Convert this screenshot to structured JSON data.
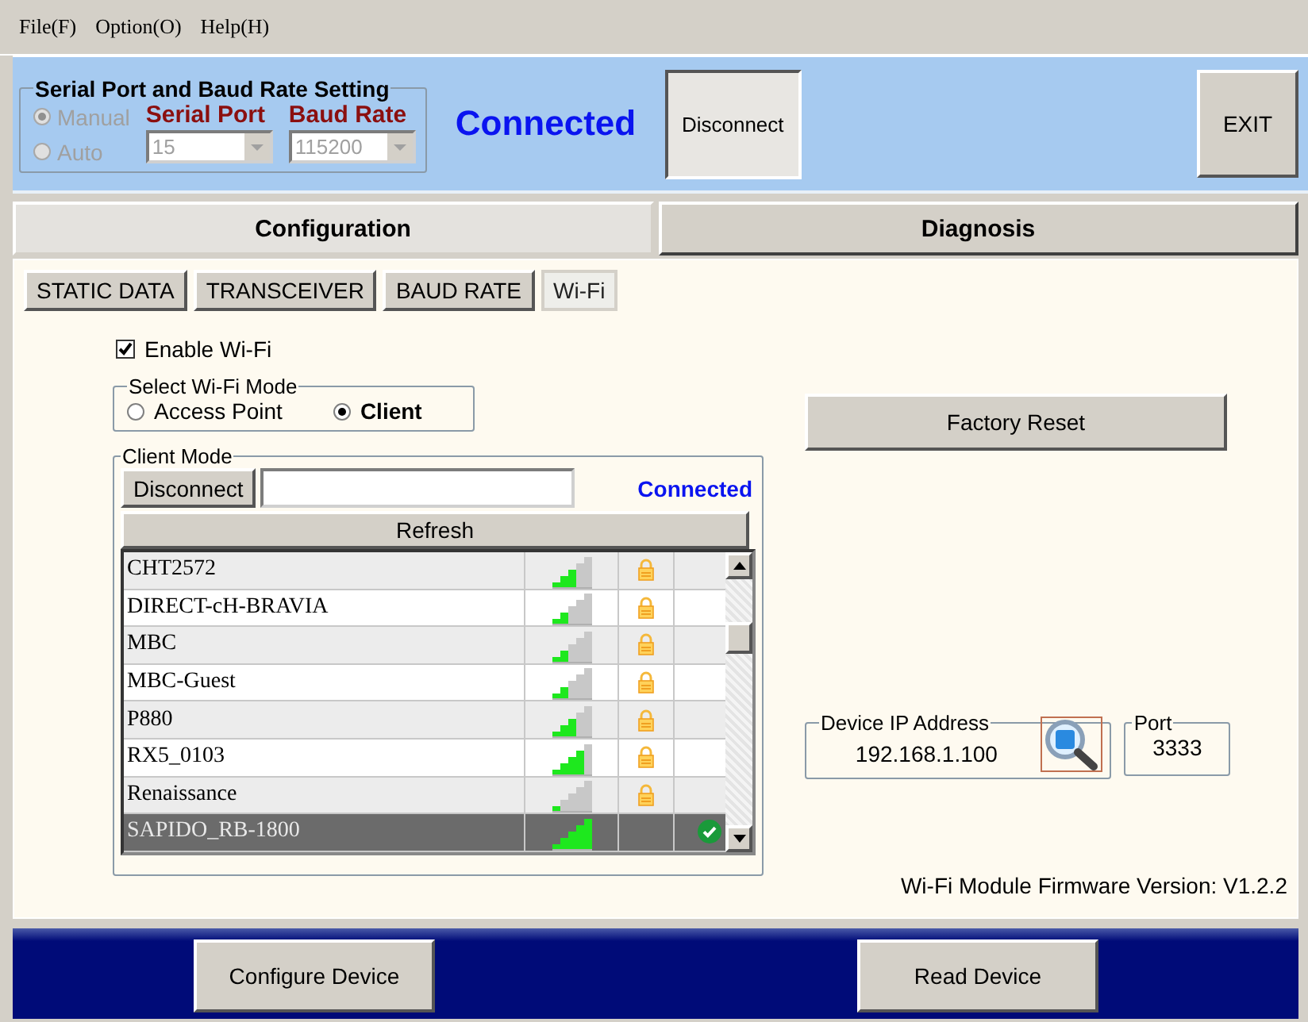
{
  "menu": [
    {
      "label": "File(F)"
    },
    {
      "label": "Option(O)"
    },
    {
      "label": "Help(H)"
    }
  ],
  "serial": {
    "title": "Serial Port and Baud Rate Setting",
    "modes": [
      {
        "label": "Manual",
        "selected": true
      },
      {
        "label": "Auto",
        "selected": false
      }
    ],
    "port_label": "Serial Port",
    "port_value": "15",
    "baud_label": "Baud Rate",
    "baud_value": "115200",
    "status": "Connected",
    "disconnect": "Disconnect",
    "exit": "EXIT"
  },
  "main_tabs": [
    {
      "label": "Configuration",
      "selected": true
    },
    {
      "label": "Diagnosis",
      "selected": false
    }
  ],
  "sub_tabs": [
    {
      "label": "STATIC DATA",
      "selected": false
    },
    {
      "label": "TRANSCEIVER",
      "selected": false
    },
    {
      "label": "BAUD RATE",
      "selected": false
    },
    {
      "label": "Wi-Fi",
      "selected": true
    }
  ],
  "enable_wifi": {
    "label": "Enable Wi-Fi",
    "checked": true
  },
  "wifi_mode": {
    "title": "Select Wi-Fi Mode",
    "options": [
      {
        "label": "Access Point",
        "selected": false
      },
      {
        "label": "Client",
        "selected": true
      }
    ]
  },
  "client_mode": {
    "title": "Client Mode",
    "disconnect": "Disconnect",
    "status": "Connected",
    "refresh": "Refresh",
    "networks": [
      {
        "name": "CHT2572",
        "level": 0.6,
        "locked": true,
        "connected": false,
        "selected": false
      },
      {
        "name": "DIRECT-cH-BRAVIA",
        "level": 0.4,
        "locked": true,
        "connected": false,
        "selected": false
      },
      {
        "name": "MBC",
        "level": 0.4,
        "locked": true,
        "connected": false,
        "selected": false
      },
      {
        "name": "MBC-Guest",
        "level": 0.4,
        "locked": true,
        "connected": false,
        "selected": false
      },
      {
        "name": "P880",
        "level": 0.6,
        "locked": true,
        "connected": false,
        "selected": false
      },
      {
        "name": "RX5_0103",
        "level": 0.8,
        "locked": true,
        "connected": false,
        "selected": false
      },
      {
        "name": "Renaissance",
        "level": 0.2,
        "locked": true,
        "connected": false,
        "selected": false
      },
      {
        "name": "SAPIDO_RB-1800",
        "level": 1,
        "locked": false,
        "connected": true,
        "selected": true
      }
    ]
  },
  "factory_reset": "Factory Reset",
  "device_ip": {
    "title": "Device IP Address",
    "value": "192.168.1.100"
  },
  "port": {
    "title": "Port",
    "value": "3333"
  },
  "firmware": "Wi-Fi Module Firmware Version: V1.2.2",
  "bottom_buttons": [
    {
      "label": "Configure Device"
    },
    {
      "label": "Read Device"
    }
  ]
}
